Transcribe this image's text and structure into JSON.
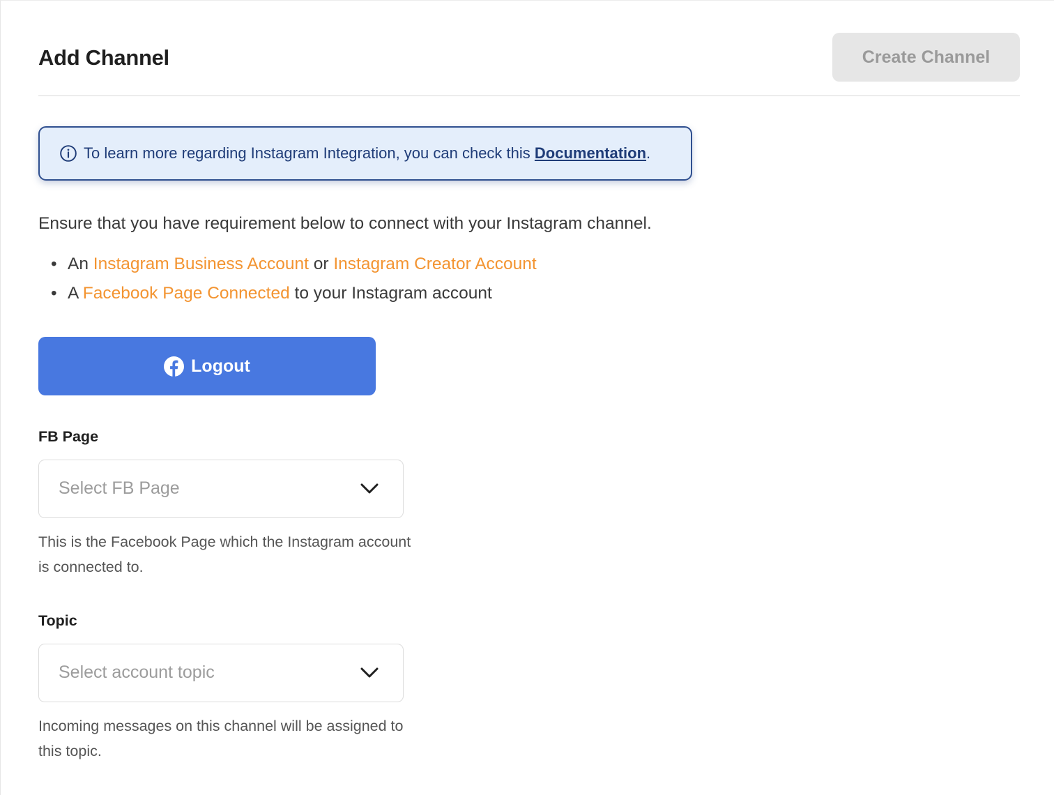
{
  "header": {
    "title": "Add Channel",
    "create_button_label": "Create Channel"
  },
  "info": {
    "icon": "info-circle-icon",
    "text_before": "To learn more regarding Instagram Integration, you can check this ",
    "link_label": "Documentation",
    "text_after": "."
  },
  "requirements": {
    "intro": "Ensure that you have requirement below to connect with your Instagram channel.",
    "items": [
      {
        "bullet": "•",
        "prefix": "An ",
        "link1": "Instagram Business Account",
        "middle": " or ",
        "link2": "Instagram Creator Account"
      },
      {
        "bullet": "•",
        "prefix": "A ",
        "link": "Facebook Page Connected",
        "suffix": " to your Instagram account"
      }
    ]
  },
  "logout_button": {
    "icon": "facebook-icon",
    "label": "Logout"
  },
  "fb_page": {
    "label": "FB Page",
    "placeholder": "Select FB Page",
    "helper": "This is the Facebook Page which the Instagram account is connected to."
  },
  "topic": {
    "label": "Topic",
    "placeholder": "Select account topic",
    "helper": "Incoming messages on this channel will be assigned to this topic."
  },
  "colors": {
    "link_orange": "#f39431",
    "primary_blue": "#4878e0",
    "info_text": "#1f3c78",
    "info_bg": "#e4eefb",
    "disabled_button_bg": "#e6e6e6"
  }
}
